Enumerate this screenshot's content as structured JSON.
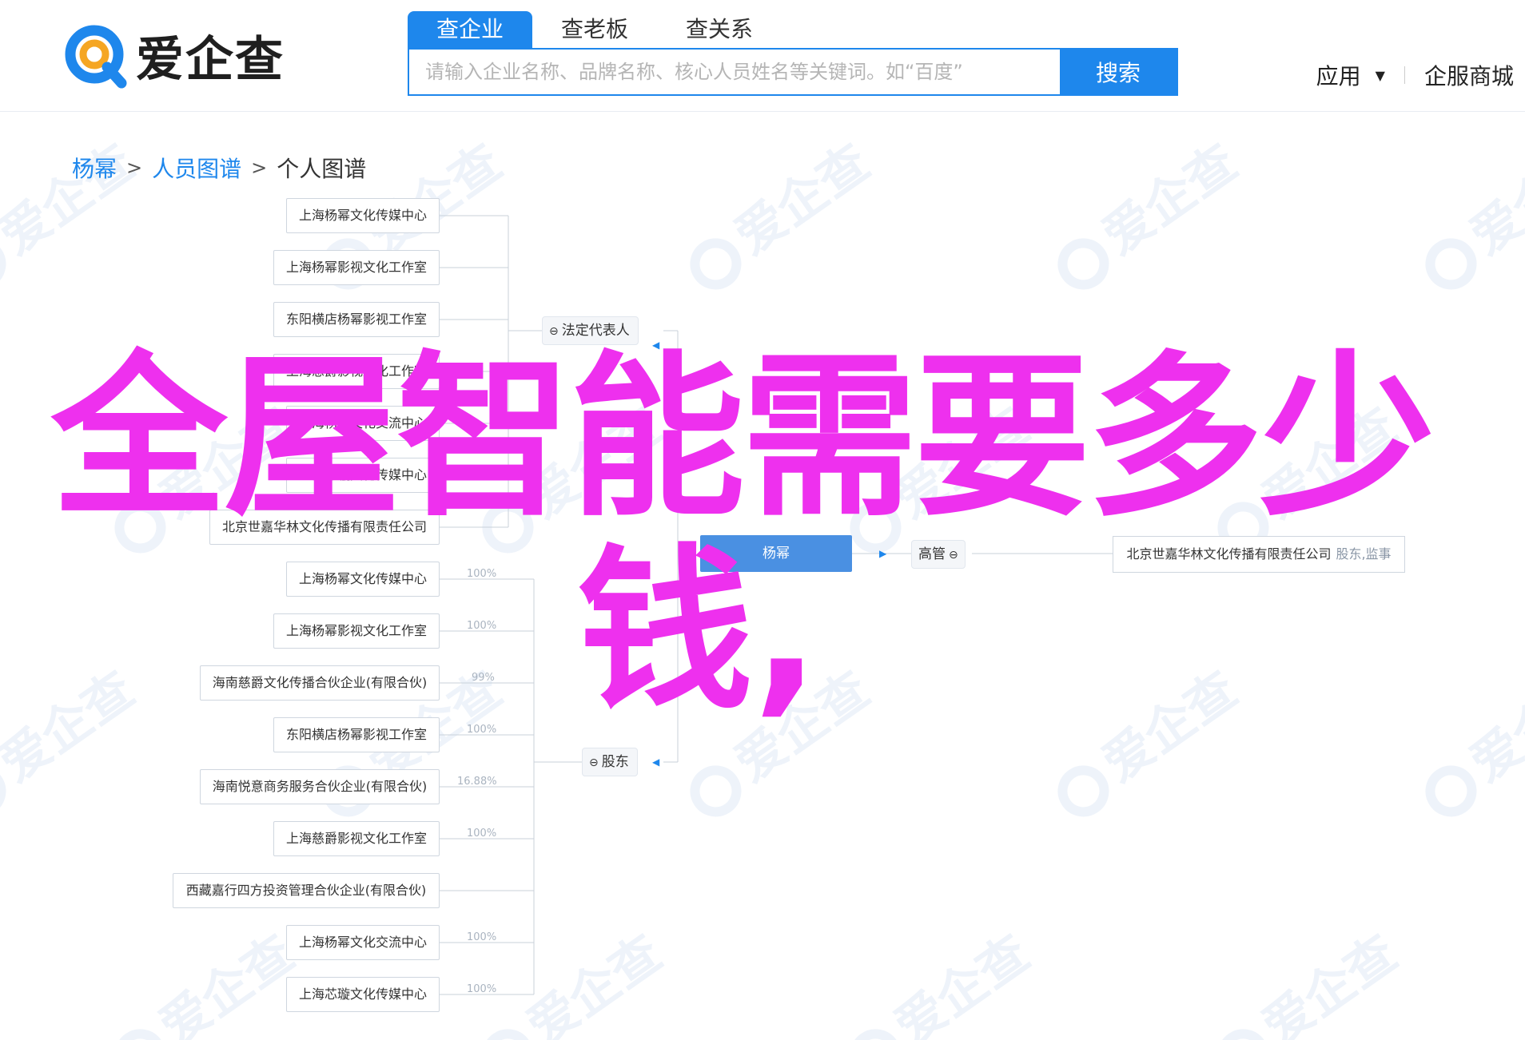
{
  "header": {
    "logo_text": "爱企查",
    "tabs": [
      {
        "label": "查企业",
        "active": true
      },
      {
        "label": "查老板",
        "active": false
      },
      {
        "label": "查关系",
        "active": false
      }
    ],
    "search_placeholder": "请输入企业名称、品牌名称、核心人员姓名等关键词。如“百度”",
    "search_button": "搜索",
    "apps_label": "应用",
    "services_label": "企服商城",
    "accent_color": "#1e87ec"
  },
  "watermark_text": "爱企查",
  "breadcrumb": {
    "items": [
      {
        "label": "杨幂",
        "link": true
      },
      {
        "label": "人员图谱",
        "link": true
      },
      {
        "label": "个人图谱",
        "link": false
      }
    ]
  },
  "graph": {
    "center_person": "杨幂",
    "legal_rep_group": {
      "label": "法定代表人",
      "companies": [
        "上海杨幂文化传媒中心",
        "上海杨幂影视文化工作室",
        "东阳横店杨幂影视工作室",
        "上海慈爵影视文化工作室",
        "上海杨幂文化交流中心",
        "上海芯璇文化传媒中心",
        "北京世嘉华林文化传播有限责任公司"
      ]
    },
    "shareholder_group": {
      "label": "股东",
      "companies": [
        {
          "name": "上海杨幂文化传媒中心",
          "pct": "100%"
        },
        {
          "name": "上海杨幂影视文化工作室",
          "pct": "100%"
        },
        {
          "name": "海南慈爵文化传播合伙企业(有限合伙)",
          "pct": "99%"
        },
        {
          "name": "东阳横店杨幂影视工作室",
          "pct": "100%"
        },
        {
          "name": "海南悦意商务服务合伙企业(有限合伙)",
          "pct": "16.88%"
        },
        {
          "name": "上海慈爵影视文化工作室",
          "pct": "100%"
        },
        {
          "name": "西藏嘉行四方投资管理合伙企业(有限合伙)",
          "pct": ""
        },
        {
          "name": "上海杨幂文化交流中心",
          "pct": "100%"
        },
        {
          "name": "上海芯璇文化传媒中心",
          "pct": "100%"
        }
      ]
    },
    "management_group": {
      "label": "高管",
      "company": "北京世嘉华林文化传播有限责任公司",
      "roles": "股东,监事"
    },
    "line_color": "#c8d0da"
  },
  "overlay": {
    "line1": "全屋智能需要多少",
    "line2": "钱,",
    "color": "#ee30ee"
  }
}
